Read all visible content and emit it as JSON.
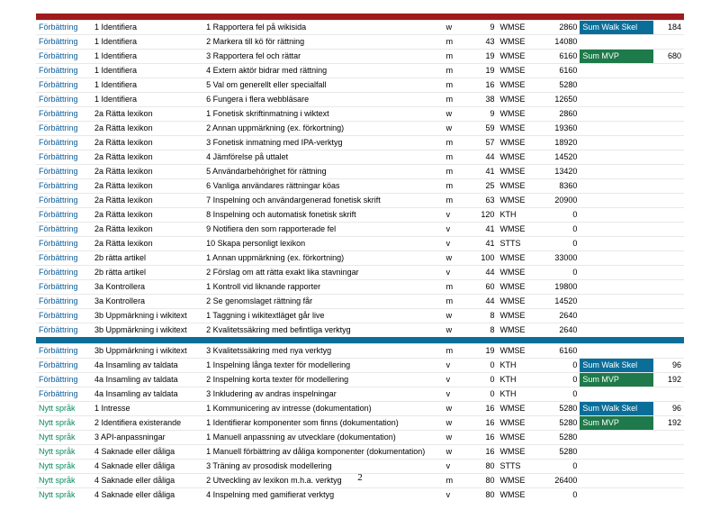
{
  "page_number": "2",
  "headers": [
    {
      "kind": "red"
    },
    {
      "kind": "blue",
      "before": 22
    }
  ],
  "side": [
    {
      "row": 0,
      "bg": "blue",
      "label": "Sum Walk Skel",
      "val": "184"
    },
    {
      "row": 2,
      "bg": "green",
      "label": "Sum MVP",
      "val": "680"
    },
    {
      "row": 23,
      "bg": "blue",
      "label": "Sum Walk Skel",
      "val": "96"
    },
    {
      "row": 24,
      "bg": "green",
      "label": "Sum MVP",
      "val": "192"
    }
  ],
  "rows": [
    {
      "a": "Förbättring",
      "b": "1 Identifiera",
      "c": "1 Rapportera fel på wikisida",
      "d": "w",
      "e": "9",
      "f": "WMSE",
      "g": "2860"
    },
    {
      "a": "Förbättring",
      "b": "1 Identifiera",
      "c": "2 Markera till kö för rättning",
      "d": "m",
      "e": "43",
      "f": "WMSE",
      "g": "14080"
    },
    {
      "a": "Förbättring",
      "b": "1 Identifiera",
      "c": "3 Rapportera fel och rättar",
      "d": "m",
      "e": "19",
      "f": "WMSE",
      "g": "6160"
    },
    {
      "a": "Förbättring",
      "b": "1 Identifiera",
      "c": "4 Extern aktör bidrar med rättning",
      "d": "m",
      "e": "19",
      "f": "WMSE",
      "g": "6160"
    },
    {
      "a": "Förbättring",
      "b": "1 Identifiera",
      "c": "5 Val om generellt eller specialfall",
      "d": "m",
      "e": "16",
      "f": "WMSE",
      "g": "5280"
    },
    {
      "a": "Förbättring",
      "b": "1 Identifiera",
      "c": "6 Fungera i flera webbläsare",
      "d": "m",
      "e": "38",
      "f": "WMSE",
      "g": "12650"
    },
    {
      "a": "Förbättring",
      "b": "2a Rätta lexikon",
      "c": "1 Fonetisk skriftinmatning i wiktext",
      "d": "w",
      "e": "9",
      "f": "WMSE",
      "g": "2860"
    },
    {
      "a": "Förbättring",
      "b": "2a Rätta lexikon",
      "c": "2 Annan uppmärkning (ex. förkortning)",
      "d": "w",
      "e": "59",
      "f": "WMSE",
      "g": "19360"
    },
    {
      "a": "Förbättring",
      "b": "2a Rätta lexikon",
      "c": "3 Fonetisk inmatning med IPA-verktyg",
      "d": "m",
      "e": "57",
      "f": "WMSE",
      "g": "18920"
    },
    {
      "a": "Förbättring",
      "b": "2a Rätta lexikon",
      "c": "4 Jämförelse på uttalet",
      "d": "m",
      "e": "44",
      "f": "WMSE",
      "g": "14520"
    },
    {
      "a": "Förbättring",
      "b": "2a Rätta lexikon",
      "c": "5 Användarbehörighet för rättning",
      "d": "m",
      "e": "41",
      "f": "WMSE",
      "g": "13420"
    },
    {
      "a": "Förbättring",
      "b": "2a Rätta lexikon",
      "c": "6 Vanliga användares rättningar köas",
      "d": "m",
      "e": "25",
      "f": "WMSE",
      "g": "8360"
    },
    {
      "a": "Förbättring",
      "b": "2a Rätta lexikon",
      "c": "7 Inspelning och användargenerad fonetisk skrift",
      "d": "m",
      "e": "63",
      "f": "WMSE",
      "g": "20900"
    },
    {
      "a": "Förbättring",
      "b": "2a Rätta lexikon",
      "c": "8 Inspelning och automatisk fonetisk skrift",
      "d": "v",
      "e": "120",
      "f": "KTH",
      "g": "0"
    },
    {
      "a": "Förbättring",
      "b": "2a Rätta lexikon",
      "c": "9 Notifiera den som rapporterade fel",
      "d": "v",
      "e": "41",
      "f": "WMSE",
      "g": "0"
    },
    {
      "a": "Förbättring",
      "b": "2a Rätta lexikon",
      "c": "10 Skapa personligt lexikon",
      "d": "v",
      "e": "41",
      "f": "STTS",
      "g": "0"
    },
    {
      "a": "Förbättring",
      "b": "2b rätta artikel",
      "c": "1 Annan uppmärkning (ex. förkortning)",
      "d": "w",
      "e": "100",
      "f": "WMSE",
      "g": "33000"
    },
    {
      "a": "Förbättring",
      "b": "2b rätta artikel",
      "c": "2 Förslag om att rätta exakt lika stavningar",
      "d": "v",
      "e": "44",
      "f": "WMSE",
      "g": "0"
    },
    {
      "a": "Förbättring",
      "b": "3a Kontrollera",
      "c": "1 Kontroll vid liknande rapporter",
      "d": "m",
      "e": "60",
      "f": "WMSE",
      "g": "19800"
    },
    {
      "a": "Förbättring",
      "b": "3a Kontrollera",
      "c": "2 Se genomslaget rättning får",
      "d": "m",
      "e": "44",
      "f": "WMSE",
      "g": "14520"
    },
    {
      "a": "Förbättring",
      "b": "3b Uppmärkning i wikitext",
      "c": "1 Taggning i wikitextläget går live",
      "d": "w",
      "e": "8",
      "f": "WMSE",
      "g": "2640"
    },
    {
      "a": "Förbättring",
      "b": "3b Uppmärkning i wikitext",
      "c": "2 Kvalitetssäkring med befintliga verktyg",
      "d": "w",
      "e": "8",
      "f": "WMSE",
      "g": "2640"
    },
    {
      "a": "Förbättring",
      "b": "3b Uppmärkning i wikitext",
      "c": "3 Kvalitetssäkring med nya verktyg",
      "d": "m",
      "e": "19",
      "f": "WMSE",
      "g": "6160"
    },
    {
      "a": "Förbättring",
      "b": "4a Insamling av taldata",
      "c": "1 Inspelning långa texter för modellering",
      "d": "v",
      "e": "0",
      "f": "KTH",
      "g": "0"
    },
    {
      "a": "Förbättring",
      "b": "4a Insamling av taldata",
      "c": "2 Inspelning korta texter för modellering",
      "d": "v",
      "e": "0",
      "f": "KTH",
      "g": "0"
    },
    {
      "a": "Förbättring",
      "b": "4a Insamling av taldata",
      "c": "3 Inkludering av andras inspelningar",
      "d": "v",
      "e": "0",
      "f": "KTH",
      "g": "0"
    },
    {
      "a": "Nytt språk",
      "b": "1 Intresse",
      "c": "1 Kommunicering av intresse (dokumentation)",
      "d": "w",
      "e": "16",
      "f": "WMSE",
      "g": "5280",
      "grp": "g"
    },
    {
      "a": "Nytt språk",
      "b": "2 Identifiera existerande",
      "c": "1 Identifierar komponenter som finns (dokumentation)",
      "d": "w",
      "e": "16",
      "f": "WMSE",
      "g": "5280",
      "grp": "g"
    },
    {
      "a": "Nytt språk",
      "b": "3 API-anpassningar",
      "c": "1 Manuell anpassning av utvecklare (dokumentation)",
      "d": "w",
      "e": "16",
      "f": "WMSE",
      "g": "5280",
      "grp": "g"
    },
    {
      "a": "Nytt språk",
      "b": "4 Saknade eller dåliga",
      "c": "1 Manuell förbättring av dåliga komponenter (dokumentation)",
      "d": "w",
      "e": "16",
      "f": "WMSE",
      "g": "5280",
      "grp": "g"
    },
    {
      "a": "Nytt språk",
      "b": "4 Saknade eller dåliga",
      "c": "3 Träning av prosodisk modellering",
      "d": "v",
      "e": "80",
      "f": "STTS",
      "g": "0",
      "grp": "g"
    },
    {
      "a": "Nytt språk",
      "b": "4 Saknade eller dåliga",
      "c": "2 Utveckling av lexikon m.h.a. verktyg",
      "d": "m",
      "e": "80",
      "f": "WMSE",
      "g": "26400",
      "grp": "g"
    },
    {
      "a": "Nytt språk",
      "b": "4 Saknade eller dåliga",
      "c": "4 Inspelning med gamifierat verktyg",
      "d": "v",
      "e": "80",
      "f": "WMSE",
      "g": "0",
      "grp": "g"
    }
  ]
}
